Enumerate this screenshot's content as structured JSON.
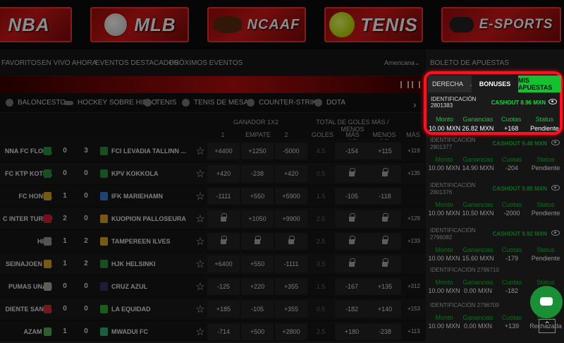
{
  "sports_banner": [
    {
      "label": "NBA",
      "icon": "basketball-icon"
    },
    {
      "label": "MLB",
      "icon": "baseball-icon"
    },
    {
      "label": "NCAAF",
      "icon": "football-icon"
    },
    {
      "label": "TENIS",
      "icon": "tennis-ball-icon"
    },
    {
      "label": "E-SPORTS",
      "icon": "gamepad-icon"
    }
  ],
  "nav": {
    "items": [
      "FAVORITOS",
      "EN VIVO AHORA",
      "EVENTOS DESTACADOS",
      "PRÓXIMOS EVENTOS"
    ],
    "odds_format": "Americana"
  },
  "sport_tabs": [
    "BALONCESTO",
    "HOCKEY SOBRE HIELO",
    "TENIS",
    "TENIS DE MESA",
    "COUNTER-STRIKE",
    "DOTA"
  ],
  "table_header": {
    "group1": "GANADOR 1X2",
    "group2": "TOTAL DE GOLES MÁS / MENOS",
    "col_1": "1",
    "col_x": "EMPATE",
    "col_2": "2",
    "col_goles": "GOLES",
    "col_mas": "MÁS DE",
    "col_menos": "MENOS DE",
    "col_more": "MÁS"
  },
  "matches": [
    {
      "home": "NNA FC FLORA",
      "hs": "0",
      "as": "3",
      "away": "FCI LEVADIA TALLINN ...",
      "o1": "+4400",
      "ox": "+1250",
      "o2": "-5000",
      "goals": "4.5",
      "over": "-154",
      "under": "+115",
      "more": "+119"
    },
    {
      "home": "FC KTP KOTKA",
      "hs": "0",
      "as": "0",
      "away": "KPV KOKKOLA",
      "o1": "+420",
      "ox": "-238",
      "o2": "+420",
      "goals": "0.5",
      "over": "",
      "under": "",
      "more": "+135"
    },
    {
      "home": "FC HONKA",
      "hs": "1",
      "as": "0",
      "away": "IFK MARIEHAMN",
      "o1": "-1111",
      "ox": "+550",
      "o2": "+5900",
      "goals": "1.5",
      "over": "-105",
      "under": "-118",
      "more": ""
    },
    {
      "home": "C INTER TURKU",
      "hs": "2",
      "as": "0",
      "away": "KUOPION PALLOSEURA",
      "o1": "",
      "ox": "+1050",
      "o2": "+9900",
      "goals": "2.5",
      "over": "",
      "under": "",
      "more": "+129"
    },
    {
      "home": "HIFK",
      "hs": "1",
      "as": "2",
      "away": "TAMPEREEN ILVES",
      "o1": "",
      "ox": "",
      "o2": "",
      "goals": "2.5",
      "over": "",
      "under": "",
      "more": "+133"
    },
    {
      "home": "SEINAJOEN JK",
      "hs": "1",
      "as": "2",
      "away": "HJK HELSINKI",
      "o1": "+6400",
      "ox": "+550",
      "o2": "-1111",
      "goals": "3.5",
      "over": "",
      "under": "",
      "more": ""
    },
    {
      "home": "PUMAS UNAM",
      "hs": "0",
      "as": "0",
      "away": "CRUZ AZUL",
      "o1": "-125",
      "ox": "+220",
      "o2": "+355",
      "goals": "1.5",
      "over": "-167",
      "under": "+135",
      "more": "+312"
    },
    {
      "home": "DIENTE SANT...",
      "hs": "0",
      "as": "0",
      "away": "LA EQUIDAD",
      "o1": "+185",
      "ox": "-105",
      "o2": "+355",
      "goals": "0.5",
      "over": "-182",
      "under": "+140",
      "more": "+153"
    },
    {
      "home": "AZAM FC",
      "hs": "1",
      "as": "0",
      "away": "MWADUI FC",
      "o1": "-714",
      "ox": "+500",
      "o2": "+2800",
      "goals": "2.5",
      "over": "+180",
      "under": "-238",
      "more": "+113"
    }
  ],
  "betslip": {
    "title": "BOLETO DE APUESTAS",
    "tab_position": "DERECHA",
    "tab_bonuses": "BONUSES",
    "tab_mybets": "MIS APUESTAS",
    "col_monto": "Monto",
    "col_ganancias": "Ganancias",
    "col_cuotas": "Cuotas",
    "col_status": "Status",
    "bets": [
      {
        "id_label": "IDENTIFICACIÓN",
        "id": "2801383",
        "cashout": "CASHOUT 8.96 MXN",
        "monto": "10.00 MXN",
        "ganancias": "26.82 MXN",
        "cuotas": "+168",
        "status": "Pendiente"
      },
      {
        "id_label": "IDENTIFICACIÓN",
        "id": "2801377",
        "cashout": "CASHOUT 9.48 MXN",
        "monto": "10.00 MXN",
        "ganancias": "14.90 MXN",
        "cuotas": "-204",
        "status": "Pendiente"
      },
      {
        "id_label": "IDENTIFICACIÓN",
        "id": "2801376",
        "cashout": "CASHOUT 9.85 MXN",
        "monto": "10.00 MXN",
        "ganancias": "10.50 MXN",
        "cuotas": "-2000",
        "status": "Pendiente"
      },
      {
        "id_label": "IDENTIFICACIÓN",
        "id": "2796082",
        "cashout": "CASHOUT 9.92 MXN",
        "monto": "10.00 MXN",
        "ganancias": "15.60 MXN",
        "cuotas": "-179",
        "status": "Pendiente"
      },
      {
        "id_label": "IDENTIFICACIÓN 2796710",
        "id": "",
        "cashout": "",
        "monto": "10.00 MXN",
        "ganancias": "0.00 MXN",
        "cuotas": "-182",
        "status": ""
      },
      {
        "id_label": "IDENTIFICACIÓN 2796709",
        "id": "",
        "cashout": "",
        "monto": "10.00 MXN",
        "ganancias": "0.00 MXN",
        "cuotas": "+139",
        "status": "Rechazada"
      }
    ]
  },
  "colors": {
    "accent_red": "#d21818",
    "green": "#1fbf3d",
    "highlight": "#ff1020"
  }
}
